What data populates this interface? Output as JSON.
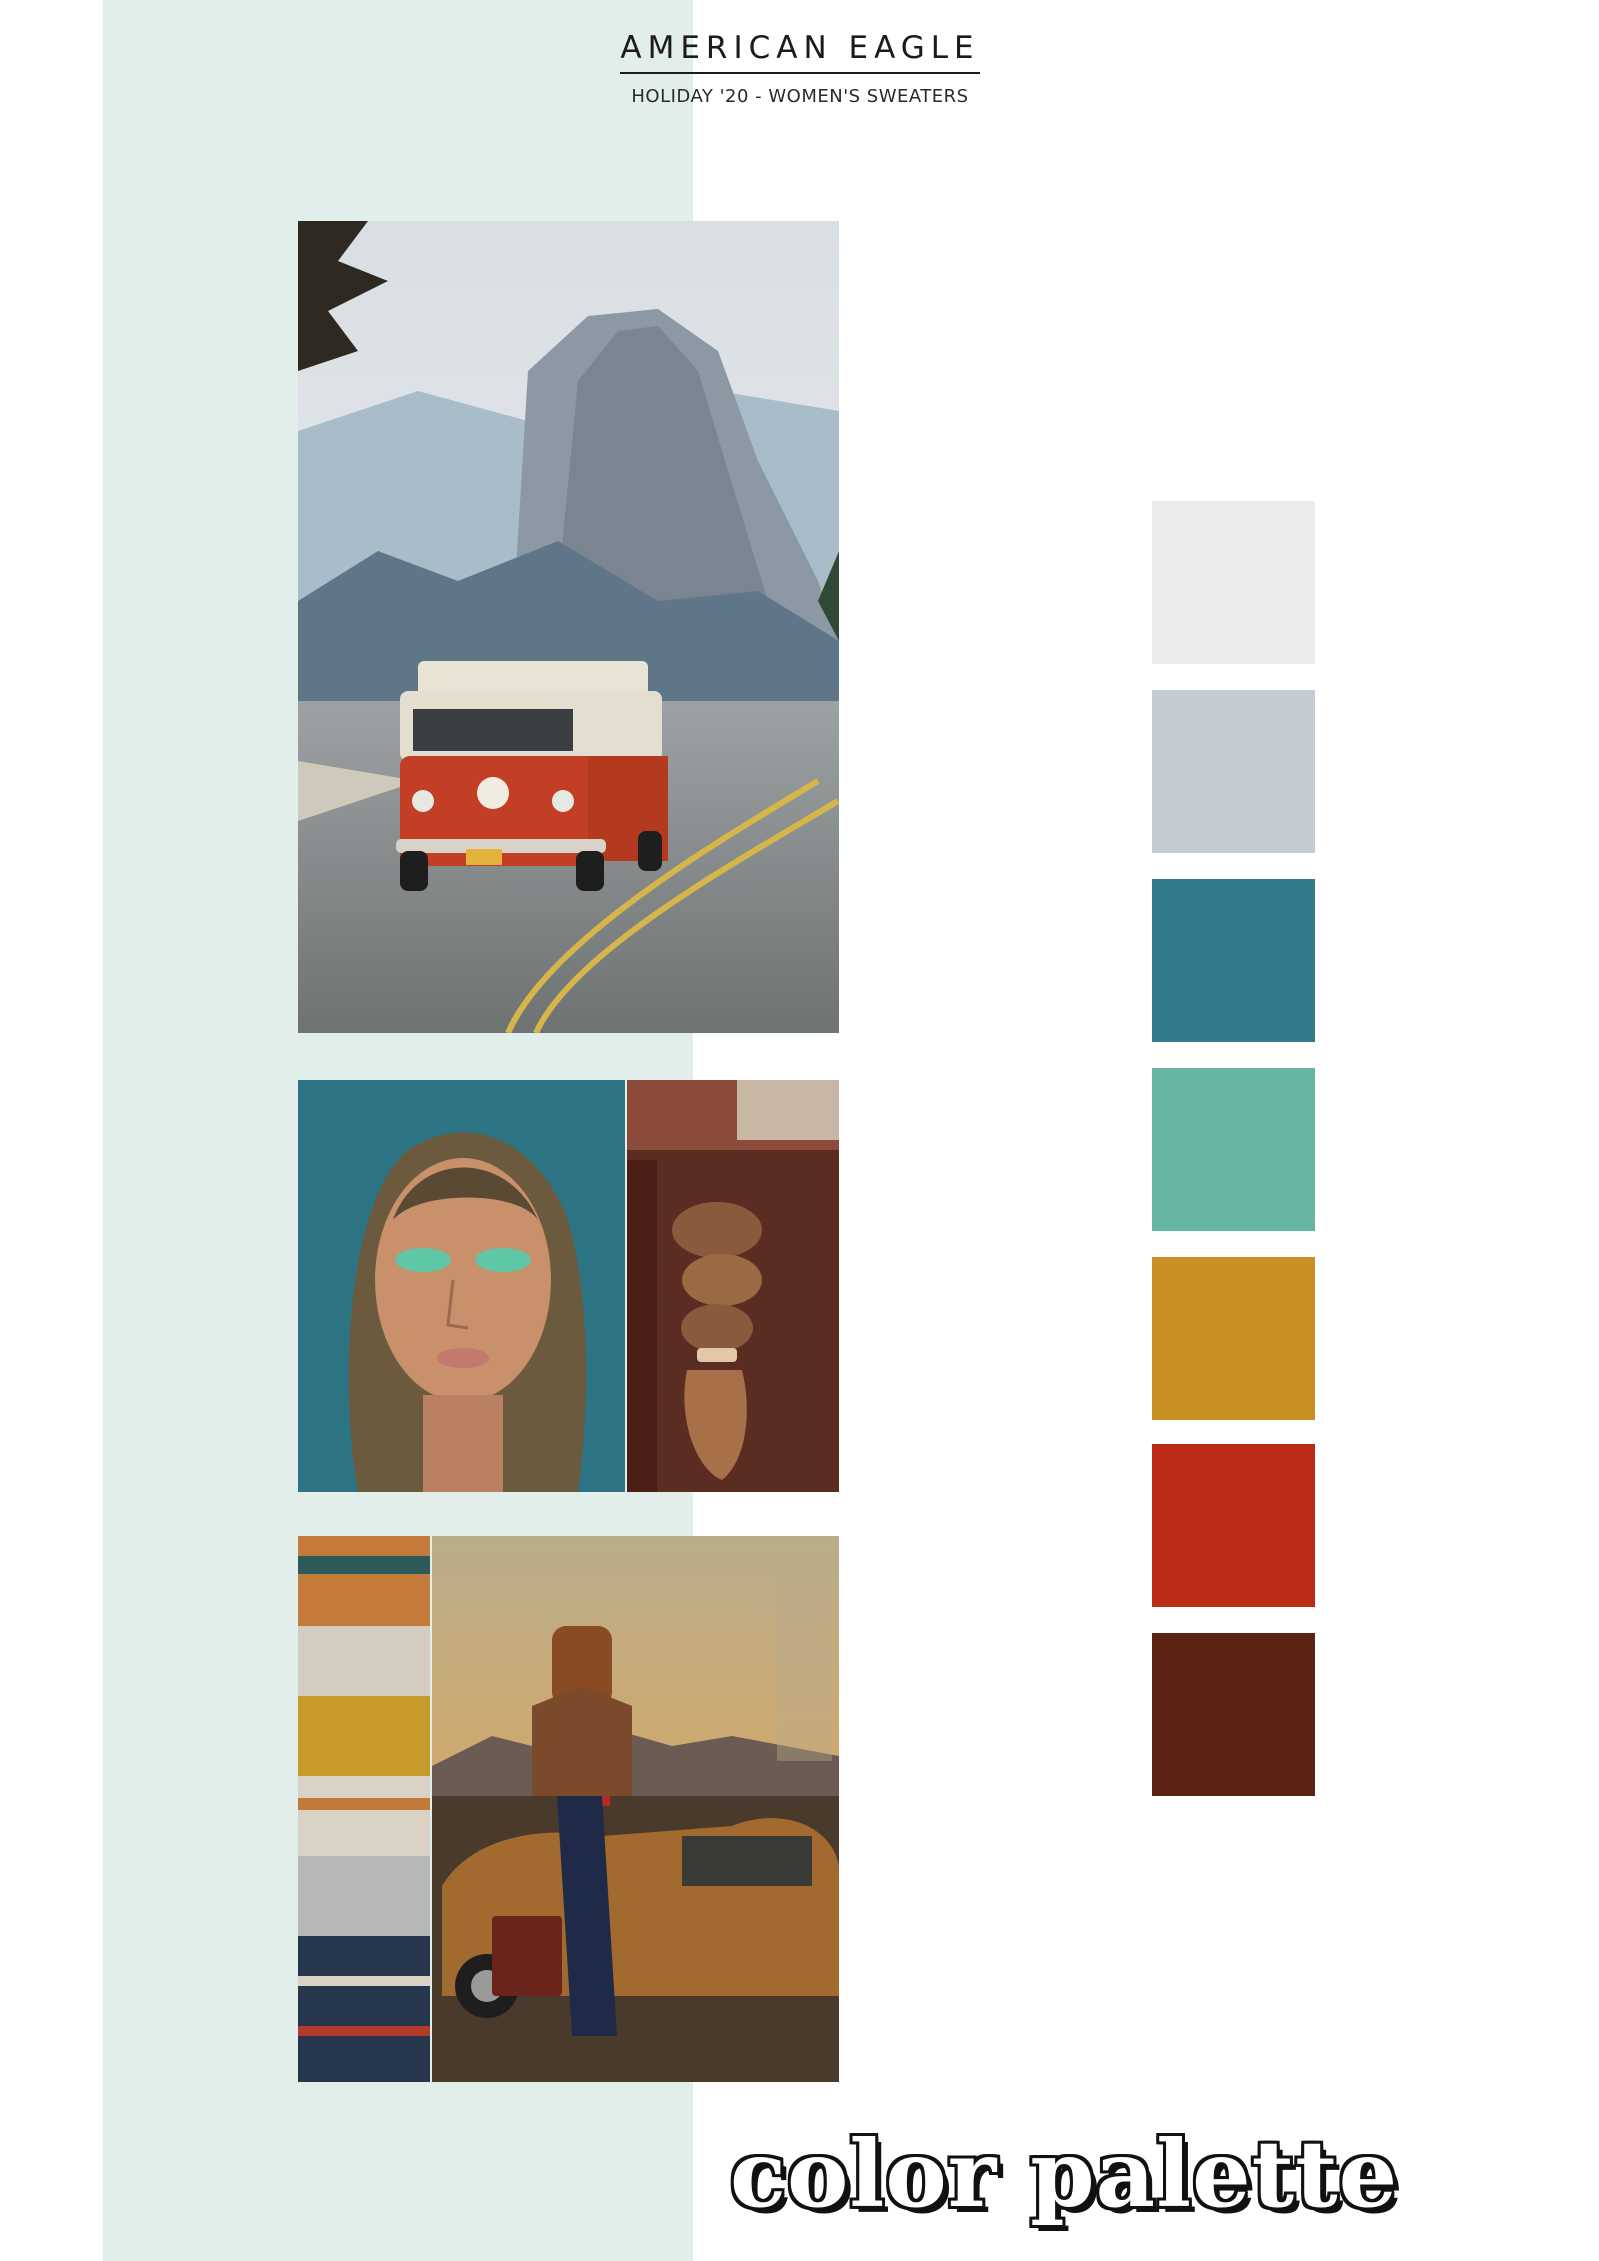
{
  "header": {
    "brand": "AMERICAN EAGLE",
    "subtitle": "HOLIDAY '20 - WOMEN'S SWEATERS"
  },
  "images": {
    "van": "vw-van-mountain-road-photo",
    "portrait": "teal-eyeshadow-portrait-photo",
    "braid": "braided-hair-sweater-photo",
    "sweaters": "folded-knit-sweaters-photo",
    "magazine": "woman-by-vintage-car-magazine-photo"
  },
  "palette": {
    "title": "color palette",
    "swatches": [
      {
        "name": "light-gray",
        "color": "#ebebea"
      },
      {
        "name": "pale-blue-gray",
        "color": "#c3ccd3"
      },
      {
        "name": "teal",
        "color": "#317b8c"
      },
      {
        "name": "seafoam",
        "color": "#65b5a2"
      },
      {
        "name": "mustard",
        "color": "#c98f22"
      },
      {
        "name": "rust-red",
        "color": "#bc2b18"
      },
      {
        "name": "chocolate-brown",
        "color": "#5a2312"
      }
    ]
  }
}
